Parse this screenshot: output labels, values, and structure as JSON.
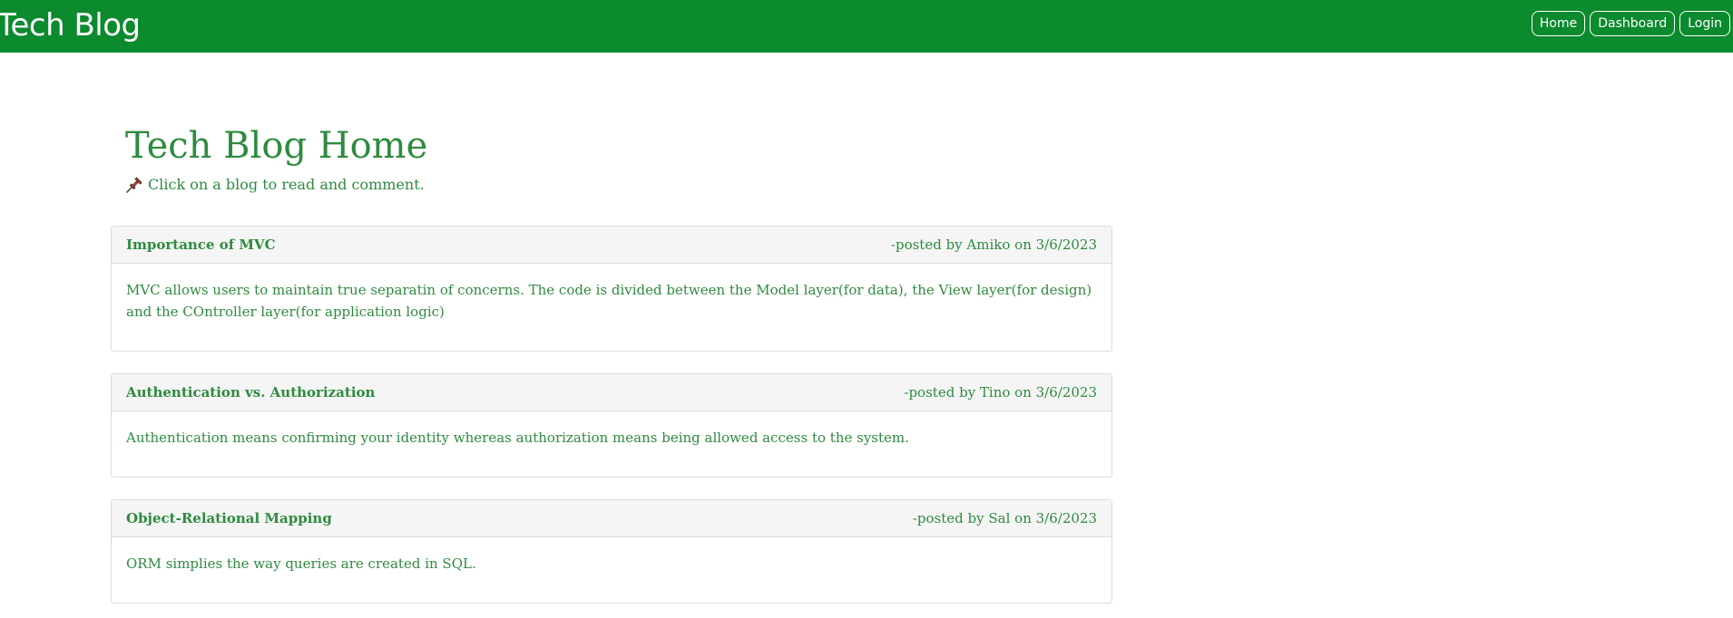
{
  "navbar": {
    "brand": "Tech Blog",
    "buttons": [
      {
        "label": "Home"
      },
      {
        "label": "Dashboard"
      },
      {
        "label": "Login"
      }
    ]
  },
  "main": {
    "title": "Tech Blog Home",
    "subtitle": "Click on a blog to read and comment.",
    "subtitle_icon": "pushpin-icon",
    "posts": [
      {
        "title": "Importance of MVC",
        "meta": "-posted by Amiko on 3/6/2023",
        "body": "MVC allows users to maintain true separatin of concerns. The code is divided between the Model layer(for data), the View layer(for design) and the COntroller layer(for application logic)"
      },
      {
        "title": "Authentication vs. Authorization",
        "meta": "-posted by Tino on 3/6/2023",
        "body": "Authentication means confirming your identity whereas authorization means being allowed access to the system."
      },
      {
        "title": "Object-Relational Mapping",
        "meta": "-posted by Sal on 3/6/2023",
        "body": "ORM simplies the way queries are created in SQL."
      }
    ]
  },
  "colors": {
    "navbar_bg": "#0c8a2e",
    "text_green": "#2e8b3e",
    "card_header_bg": "#f5f5f5"
  }
}
